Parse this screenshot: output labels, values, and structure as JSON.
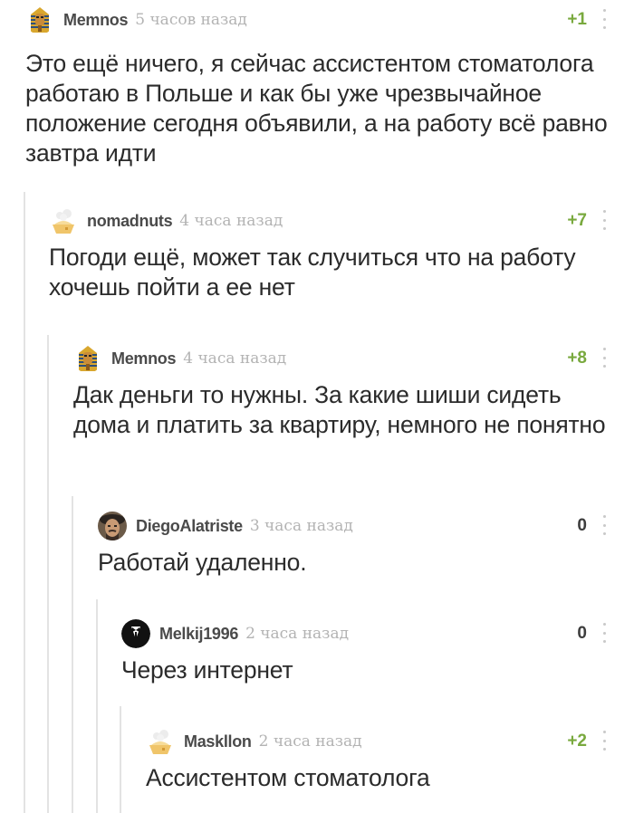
{
  "comments": [
    {
      "username": "Memnos",
      "time": "5 часов назад",
      "rating": "+1",
      "text": "Это ещё ничего, я сейчас ассистентом стоматолога работаю в Польше и как бы уже чрезвычайное положение сегодня объявили, а на работу всё равно завтра идти",
      "avatar": "pharaoh-avatar"
    },
    {
      "username": "nomadnuts",
      "time": "4 часа назад",
      "rating": "+7",
      "text": "Погоди ещё, может так случиться что на работу хочешь пойти а ее нет",
      "avatar": "default-avatar"
    },
    {
      "username": "Memnos",
      "time": "4 часа назад",
      "rating": "+8",
      "text": "Дак деньги то нужны. За какие шиши сидеть дома и платить за квартиру, немного не понятно",
      "avatar": "pharaoh-avatar"
    },
    {
      "username": "DiegoAlatriste",
      "time": "3 часа назад",
      "rating": "0",
      "text": "Работай удаленно.",
      "avatar": "portrait-avatar"
    },
    {
      "username": "Melkij1996",
      "time": "2 часа назад",
      "rating": "0",
      "text": "Через интернет",
      "avatar": "tuxedo-avatar"
    },
    {
      "username": "Maskllon",
      "time": "2 часа назад",
      "rating": "+2",
      "text": "Ассистентом стоматолога",
      "avatar": "default-avatar"
    }
  ],
  "colors": {
    "positive_rating": "#79a93e",
    "neutral_rating": "#3d3d3d",
    "time": "#b3b3b3",
    "thread_line": "#e3e3e3"
  }
}
